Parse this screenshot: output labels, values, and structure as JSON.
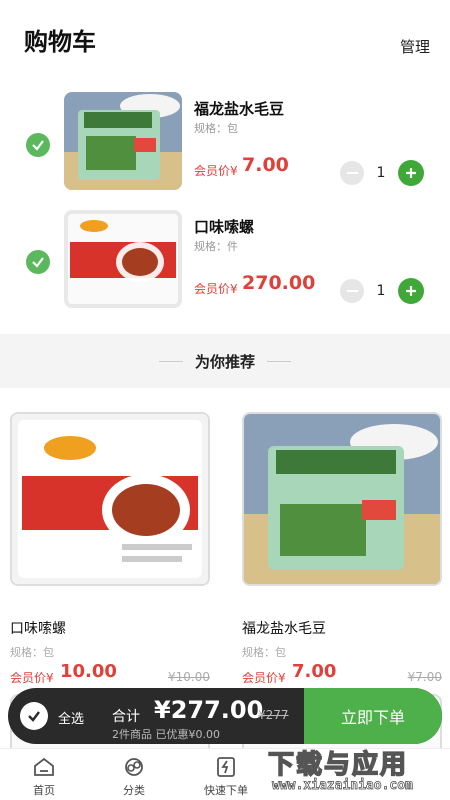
{
  "header": {
    "title": "购物车",
    "manage_label": "管理"
  },
  "cart": {
    "items": [
      {
        "name": "福龙盐水毛豆",
        "spec": "规格：包",
        "price_label": "会员价¥",
        "price": "7.00",
        "quantity": "1",
        "image": "edamame-package-image",
        "selected": true
      },
      {
        "name": "口味嗦螺",
        "spec": "规格：件",
        "price_label": "会员价¥",
        "price": "270.00",
        "quantity": "1",
        "image": "snail-package-image",
        "selected": true
      }
    ]
  },
  "recommend": {
    "title": "为你推荐",
    "items": [
      {
        "name": "口味嗦螺",
        "spec": "规格：包",
        "price_label": "会员价¥",
        "price": "10.00",
        "old_price": "¥10.00",
        "image": "snail-package-image"
      },
      {
        "name": "福龙盐水毛豆",
        "spec": "规格：包",
        "price_label": "会员价¥",
        "price": "7.00",
        "old_price": "¥7.00",
        "image": "edamame-package-image"
      }
    ]
  },
  "checkout": {
    "select_all_label": "全选",
    "total_label": "合计",
    "total_value": "¥277.00",
    "total_old": "¥277",
    "summary": "2件商品 已优惠¥0.00",
    "button_label": "立即下单"
  },
  "tabbar": {
    "items": [
      {
        "label": "首页",
        "icon": "home-icon"
      },
      {
        "label": "分类",
        "icon": "category-icon"
      },
      {
        "label": "快速下单",
        "icon": "quick-order-icon"
      }
    ]
  },
  "watermark": {
    "text": "下载与应用",
    "url": "www.xiazainiao.com"
  },
  "colors": {
    "accent_green": "#4eb04a",
    "price_red": "#e0403a",
    "dark_bar": "#2a2a2a"
  }
}
